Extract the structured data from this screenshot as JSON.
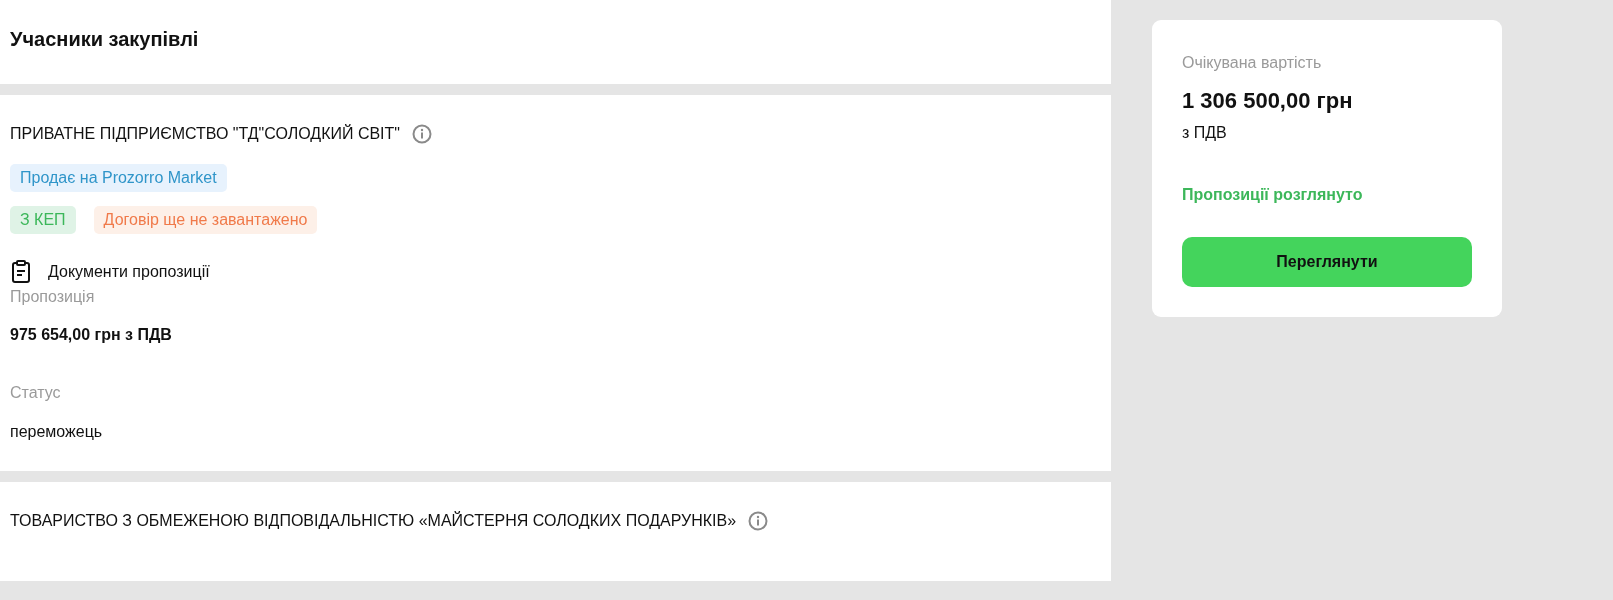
{
  "page_title": "Учасники закупівлі",
  "participants": [
    {
      "name": "ПРИВАТНЕ ПІДПРИЄМСТВО \"ТД\"СОЛОДКИЙ СВІТ\"",
      "tag_rows": [
        [
          {
            "kind": "market",
            "label": "Продає на Prozorro Market"
          }
        ],
        [
          {
            "kind": "signed",
            "label": "З КЕП"
          },
          {
            "kind": "warning",
            "label": "Договір ще не завантажено"
          }
        ]
      ],
      "documents_link": "Документи пропозиції",
      "offer_label": "Пропозиція",
      "offer_value": "975 654,00 грн з ПДВ",
      "status_label": "Статус",
      "status_value": "переможець"
    },
    {
      "name": "ТОВАРИСТВО З ОБМЕЖЕНОЮ ВІДПОВІДАЛЬНІСТЮ «МАЙСТЕРНЯ СОЛОДКИХ ПОДАРУНКІВ»"
    }
  ],
  "summary": {
    "label": "Очікувана вартість",
    "amount": "1 306 500,00 грн",
    "vat": "з ПДВ",
    "status": "Пропозиції розглянуто",
    "button": "Переглянути"
  }
}
